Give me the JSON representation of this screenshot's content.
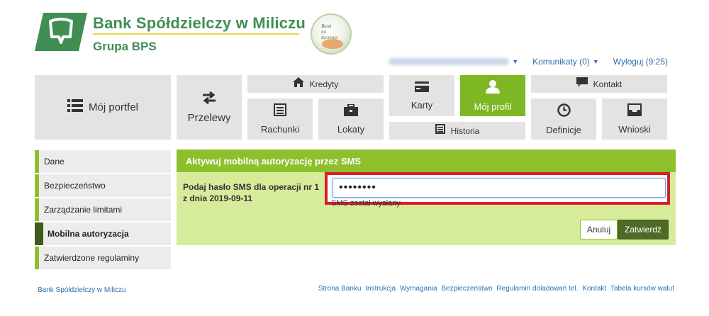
{
  "header": {
    "bank_name": "Bank Spółdzielczy w Miliczu",
    "group": "Grupa BPS",
    "badge_text": "Bank na życzenie"
  },
  "topnav": {
    "user_label": "",
    "messages": "Komunikaty (0)",
    "logout": "Wyloguj (9:25)"
  },
  "menu": {
    "portfel": "Mój portfel",
    "przelewy": "Przelewy",
    "kredyty": "Kredyty",
    "rachunki": "Rachunki",
    "lokaty": "Lokaty",
    "karty": "Karty",
    "historia": "Historia",
    "profil": "Mój profil",
    "kontakt": "Kontakt",
    "definicje": "Definicje",
    "wnioski": "Wnioski"
  },
  "sidebar": {
    "items": [
      {
        "label": "Dane"
      },
      {
        "label": "Bezpieczeństwo"
      },
      {
        "label": "Zarządzanie limitami"
      },
      {
        "label": "Mobilna autoryzacja"
      },
      {
        "label": "Zatwierdzone regulaminy"
      }
    ]
  },
  "panel": {
    "title": "Aktywuj mobilną autoryzację przez SMS",
    "prompt": "Podaj hasło SMS dla operacji nr 1 z dnia 2019-09-11",
    "sms_value": "••••••••",
    "sms_note": "SMS został wysłany",
    "cancel": "Anuluj",
    "confirm": "Zatwierdź"
  },
  "footer": {
    "left": "Bank Spółdzielczy w Miliczu",
    "links": [
      "Strona Banku",
      "Instrukcja",
      "Wymagania",
      "Bezpieczeństwo",
      "Regulamin doladowań tel.",
      "Kontakt",
      "Tabela kursów walut"
    ]
  },
  "colors": {
    "brand_green": "#3f8f55",
    "accent_green": "#7db824",
    "panel_green": "#d6ec9a",
    "highlight_red": "#d81e2a",
    "link_blue": "#2f6fae"
  }
}
